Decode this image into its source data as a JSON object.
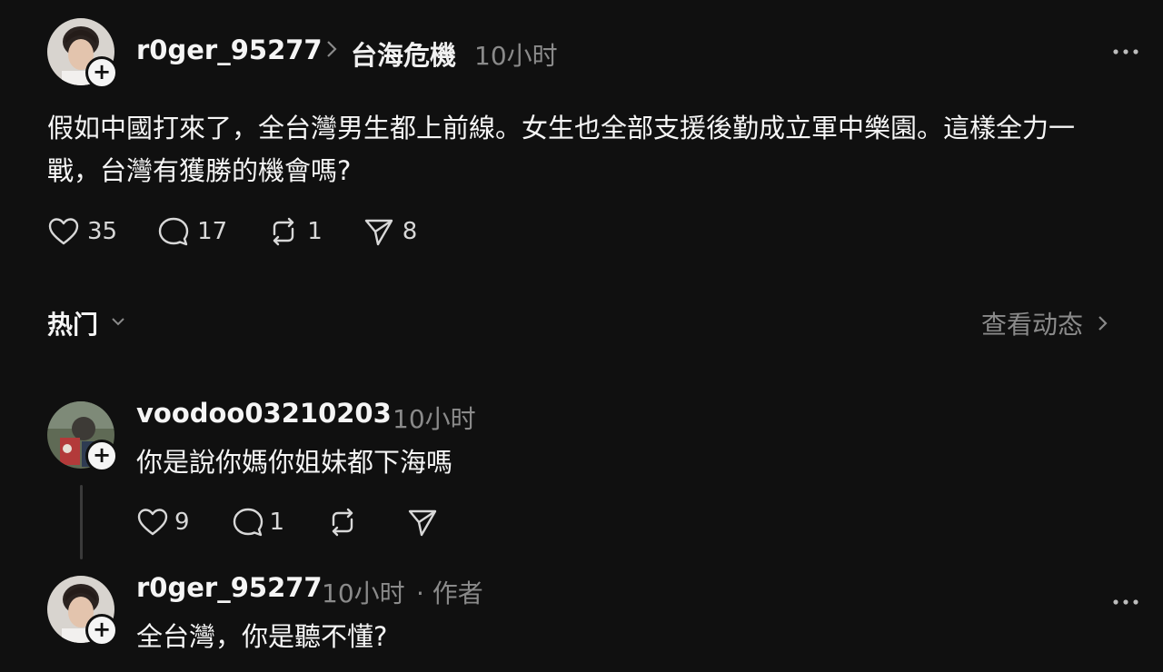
{
  "post": {
    "username": "r0ger_95277",
    "topic": "台海危機",
    "time": "10小时",
    "text_line1": "假如中國打來了，全台灣男生都上前線。女生也全部支援後勤成立軍中樂園。這樣全力一",
    "text_line2": "戰，台灣有獲勝的機會嗎?",
    "likes": "35",
    "comments": "17",
    "reposts": "1",
    "shares": "8"
  },
  "section": {
    "sort_label": "热门",
    "view_activity": "查看动态"
  },
  "comments": [
    {
      "username": "voodoo03210203",
      "time": "10小时",
      "text": "你是說你媽你姐妹都下海嗎",
      "likes": "9",
      "replies": "1"
    },
    {
      "username": "r0ger_95277",
      "time": "10小时",
      "author_tag": "· 作者",
      "text": "全台灣，你是聽不懂?"
    }
  ],
  "icons": {
    "like": "heart-icon",
    "comment": "comment-bubble-icon",
    "repost": "repost-icon",
    "share": "send-icon",
    "more": "more-dots-icon",
    "follow": "plus-icon"
  }
}
